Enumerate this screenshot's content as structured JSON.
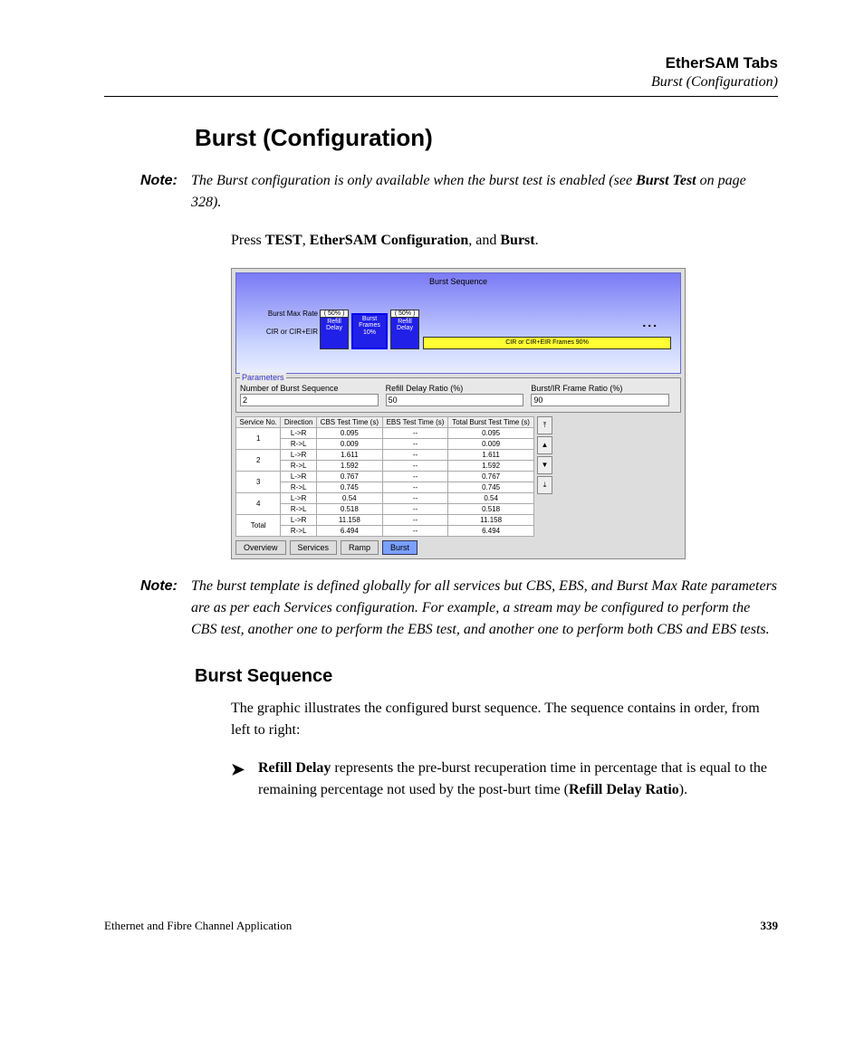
{
  "header": {
    "title": "EtherSAM Tabs",
    "subtitle": "Burst (Configuration)"
  },
  "h1": "Burst (Configuration)",
  "note1_label": "Note:",
  "note1_pre": "The Burst configuration is only available when the burst test is enabled (see ",
  "note1_link": "Burst Test",
  "note1_post": " on page 328).",
  "para1_pre": "Press ",
  "para1_b1": "TEST",
  "para1_mid1": ", ",
  "para1_b2": "EtherSAM Configuration",
  "para1_mid2": ", and ",
  "para1_b3": "Burst",
  "para1_end": ".",
  "screenshot": {
    "seq_title": "Burst Sequence",
    "axis_top": "Burst Max Rate",
    "axis_bot": "CIR or CIR+EIR",
    "refill_head": "( 50% )",
    "refill_body": "Refill\nDelay",
    "burst_body": "Burst\nFrames\n10%",
    "cir_body": "CIR or CIR+EIR Frames 90%",
    "dots": "...",
    "params_legend": "Parameters",
    "p1_label": "Number of Burst Sequence",
    "p1_value": "2",
    "p2_label": "Refill Delay Ratio (%)",
    "p2_value": "50",
    "p3_label": "Burst/IR Frame Ratio (%)",
    "p3_value": "90",
    "table": {
      "headers": [
        "Service No.",
        "Direction",
        "CBS Test Time (s)",
        "EBS Test Time (s)",
        "Total Burst Test Time (s)"
      ],
      "rows": [
        {
          "svc": "1",
          "dir": "L->R",
          "cbs": "0.095",
          "ebs": "--",
          "tot": "0.095"
        },
        {
          "svc": "",
          "dir": "R->L",
          "cbs": "0.009",
          "ebs": "--",
          "tot": "0.009"
        },
        {
          "svc": "2",
          "dir": "L->R",
          "cbs": "1.611",
          "ebs": "--",
          "tot": "1.611"
        },
        {
          "svc": "",
          "dir": "R->L",
          "cbs": "1.592",
          "ebs": "--",
          "tot": "1.592"
        },
        {
          "svc": "3",
          "dir": "L->R",
          "cbs": "0.767",
          "ebs": "--",
          "tot": "0.767"
        },
        {
          "svc": "",
          "dir": "R->L",
          "cbs": "0.745",
          "ebs": "--",
          "tot": "0.745"
        },
        {
          "svc": "4",
          "dir": "L->R",
          "cbs": "0.54",
          "ebs": "--",
          "tot": "0.54"
        },
        {
          "svc": "",
          "dir": "R->L",
          "cbs": "0.518",
          "ebs": "--",
          "tot": "0.518"
        },
        {
          "svc": "Total",
          "dir": "L->R",
          "cbs": "11.158",
          "ebs": "--",
          "tot": "11.158"
        },
        {
          "svc": "",
          "dir": "R->L",
          "cbs": "6.494",
          "ebs": "--",
          "tot": "6.494"
        }
      ]
    },
    "tabs": [
      "Overview",
      "Services",
      "Ramp",
      "Burst"
    ],
    "active_tab": "Burst",
    "scroll": [
      "⤒",
      "▲",
      "▼",
      "⤓"
    ]
  },
  "note2_label": "Note:",
  "note2_body": "The burst template is defined globally for all services but CBS, EBS, and Burst Max Rate parameters are as per each Services configuration. For example, a stream may be configured to perform the CBS test, another one to perform the EBS test, and another one to perform both CBS and EBS tests.",
  "h2": "Burst Sequence",
  "para2": "The graphic illustrates the configured burst sequence. The sequence contains in order, from left to right:",
  "bullet1_b1": "Refill Delay",
  "bullet1_mid": " represents the pre-burst recuperation time in percentage that is equal to the remaining percentage not used by the post-burt time (",
  "bullet1_b2": "Refill Delay Ratio",
  "bullet1_end": ").",
  "footer": {
    "left": "Ethernet and Fibre Channel Application",
    "right": "339"
  }
}
